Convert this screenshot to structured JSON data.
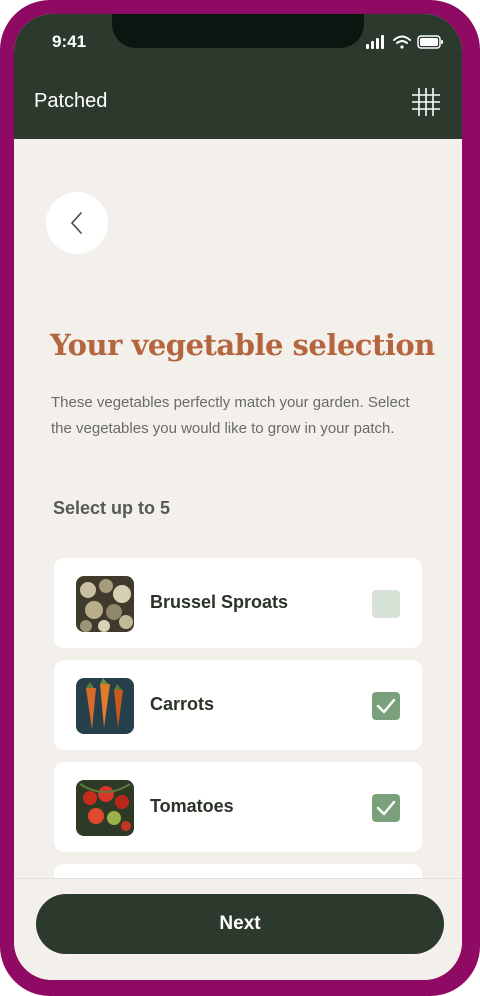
{
  "status_bar": {
    "time": "9:41"
  },
  "header": {
    "title": "Patched"
  },
  "page": {
    "heading": "Your vegetable selection",
    "description": "These vegetables perfectly match your garden. Select the vegetables you would like to grow in your patch.",
    "select_hint": "Select up to 5"
  },
  "vegetables": [
    {
      "name": "Brussel Sproats",
      "checked": false,
      "thumb_icon": "brussels-sprouts-image"
    },
    {
      "name": "Carrots",
      "checked": true,
      "thumb_icon": "carrots-image"
    },
    {
      "name": "Tomatoes",
      "checked": true,
      "thumb_icon": "tomatoes-image"
    }
  ],
  "footer": {
    "next_label": "Next"
  },
  "colors": {
    "frame": "#8f0a63",
    "header_bg": "#2b3a2d",
    "accent_heading": "#b4653e",
    "checkbox_on": "#7aa07c",
    "checkbox_off": "#d7e2d6",
    "background": "#f3f0eb"
  }
}
